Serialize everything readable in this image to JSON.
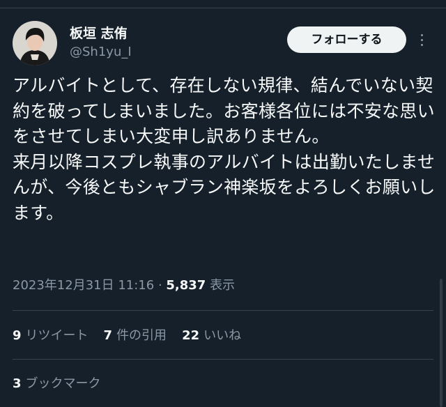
{
  "author": {
    "display_name": "板垣 志侑",
    "handle": "@Sh1yu_I"
  },
  "header": {
    "follow_label": "フォローする"
  },
  "tweet": {
    "text": "アルバイトとして、存在しない規律、結んでいない契約を破ってしまいました。お客様各位には不安な思いをさせてしまい大変申し訳ありません。\n来月以降コスプレ執事のアルバイトは出勤いたしませんが、今後ともシャブラン神楽坂をよろしくお願いします。",
    "timestamp": "2023年12月31日 11:16",
    "separator": " · ",
    "views_count": "5,837",
    "views_label": "表示"
  },
  "stats": {
    "retweets_count": "9",
    "retweets_label": "リツイート",
    "quotes_count": "7",
    "quotes_label": "件の引用",
    "likes_count": "22",
    "likes_label": "いいね",
    "bookmarks_count": "3",
    "bookmarks_label": "ブックマーク"
  },
  "icons": {
    "more": "more-options-icon"
  },
  "colors": {
    "background": "#15202b",
    "text_primary": "#f7f9f9",
    "text_secondary": "#8b98a5",
    "divider": "#38444d",
    "follow_bg": "#eff3f4"
  }
}
